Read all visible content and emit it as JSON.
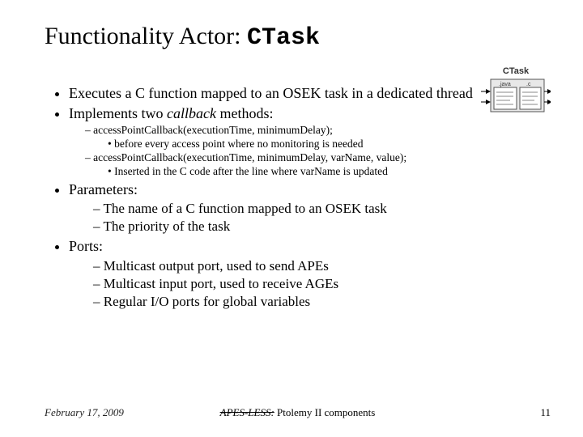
{
  "title": {
    "prefix": "Functionality Actor: ",
    "code": "CTask"
  },
  "diagram": {
    "caption": "CTask",
    "left_label": ".java",
    "right_label": ".c"
  },
  "bullets": {
    "b1": "Executes a C function mapped to an OSEK task in a dedicated thread",
    "b2_pre": "Implements two ",
    "b2_em": "callback",
    "b2_post": " methods:",
    "cb1": "accessPointCallback(executionTime, minimumDelay);",
    "cb1_sub": "before every access point where no monitoring is needed",
    "cb2": "accessPointCallback(executionTime, minimumDelay, varName, value);",
    "cb2_sub": "Inserted in the C code after the line where varName is updated",
    "b3": "Parameters:",
    "p1": "The name of a C function mapped to an OSEK task",
    "p2": "The priority of the task",
    "b4": "Ports:",
    "port1": "Multicast output port, used to send APEs",
    "port2": "Multicast input port, used to receive AGEs",
    "port3": "Regular I/O ports for global variables"
  },
  "footer": {
    "date": "February 17, 2009",
    "center_strike": "APES-LESS:",
    "center_rest": " Ptolemy II components",
    "page": "11"
  }
}
